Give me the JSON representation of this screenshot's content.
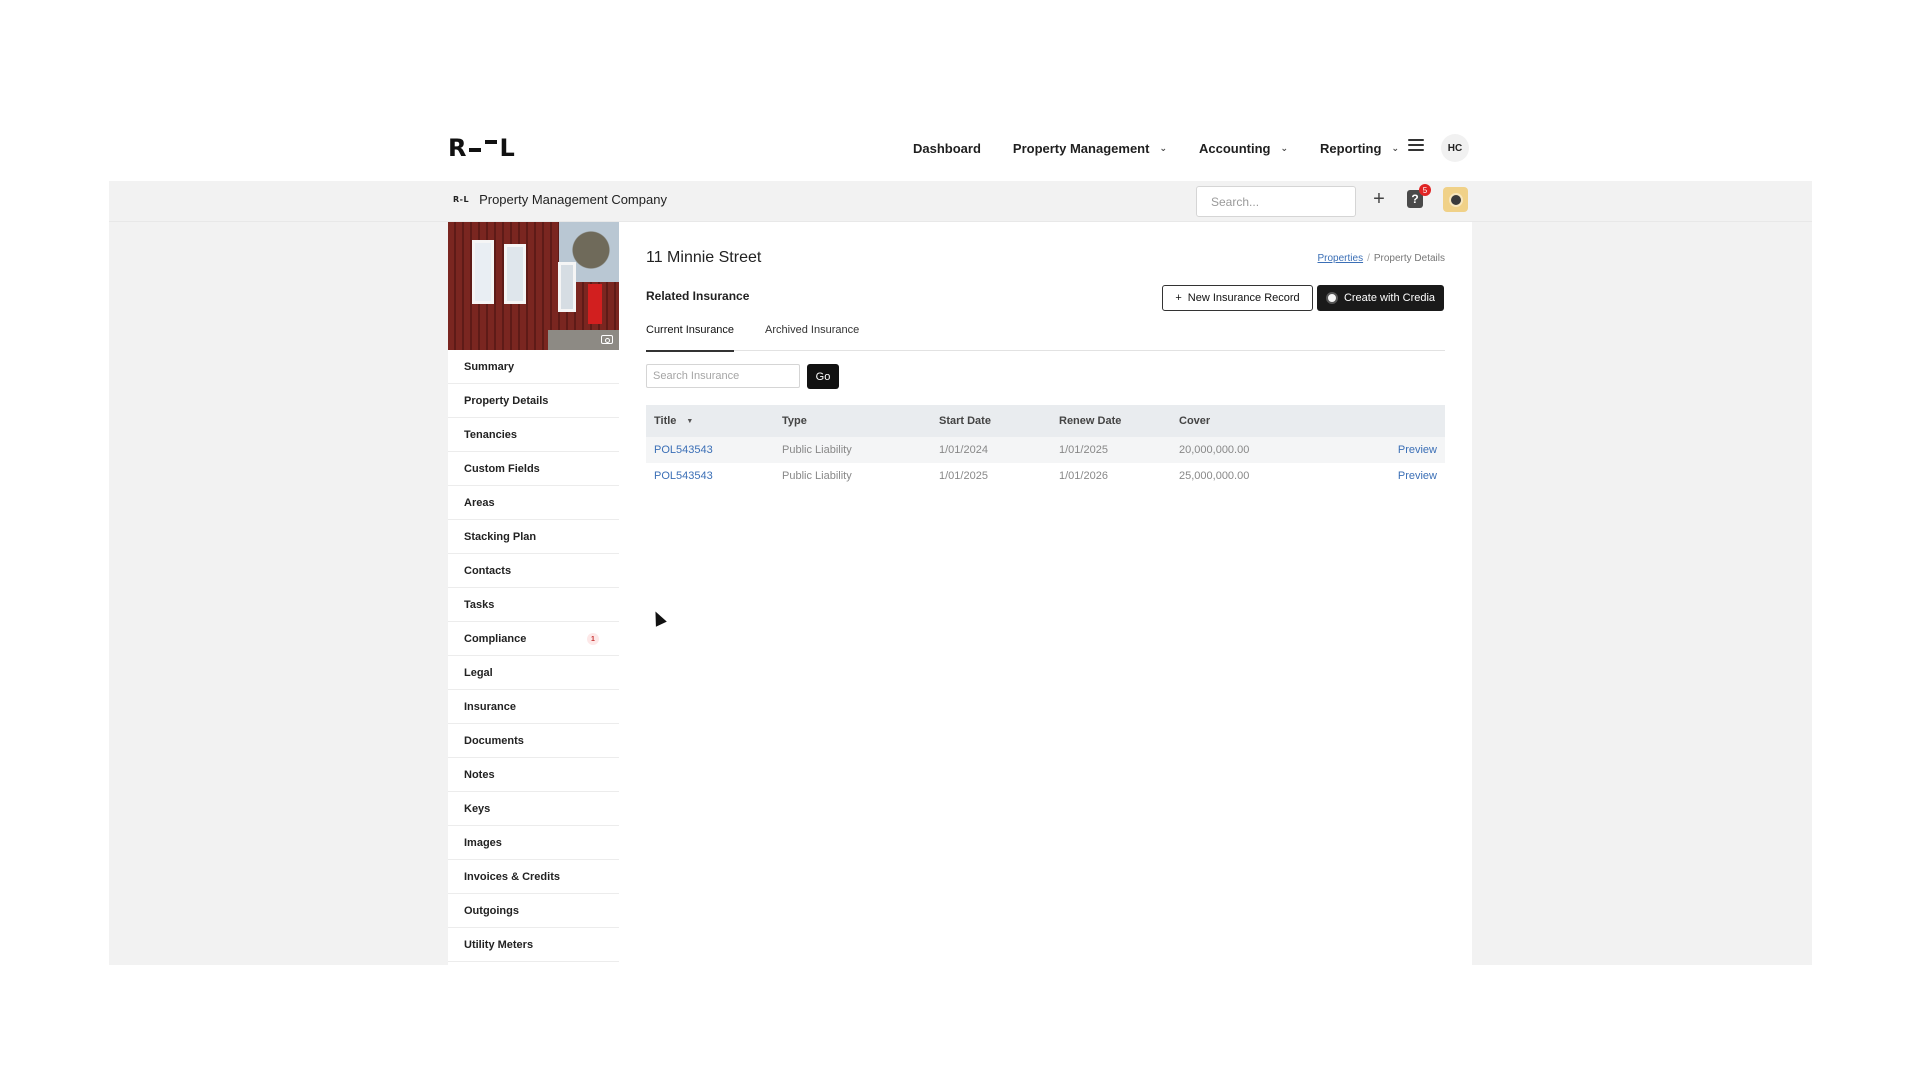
{
  "app": {
    "logo_text_left": "R",
    "logo_text_right": "L",
    "mini_logo": "R-L"
  },
  "nav": {
    "items": [
      {
        "label": "Dashboard",
        "dropdown": false
      },
      {
        "label": "Property Management",
        "dropdown": true
      },
      {
        "label": "Accounting",
        "dropdown": true
      },
      {
        "label": "Reporting",
        "dropdown": true
      }
    ],
    "user_initials": "HC"
  },
  "subheader": {
    "company": "Property Management Company",
    "search_placeholder": "Search...",
    "notification_count": "5",
    "help_glyph": "?"
  },
  "sidebar": {
    "items": [
      {
        "label": "Summary",
        "count": ""
      },
      {
        "label": "Property Details",
        "count": ""
      },
      {
        "label": "Tenancies",
        "count": ""
      },
      {
        "label": "Custom Fields",
        "count": ""
      },
      {
        "label": "Areas",
        "count": ""
      },
      {
        "label": "Stacking Plan",
        "count": ""
      },
      {
        "label": "Contacts",
        "count": ""
      },
      {
        "label": "Tasks",
        "count": ""
      },
      {
        "label": "Compliance",
        "count": "1"
      },
      {
        "label": "Legal",
        "count": ""
      },
      {
        "label": "Insurance",
        "count": ""
      },
      {
        "label": "Documents",
        "count": ""
      },
      {
        "label": "Notes",
        "count": ""
      },
      {
        "label": "Keys",
        "count": ""
      },
      {
        "label": "Images",
        "count": ""
      },
      {
        "label": "Invoices & Credits",
        "count": ""
      },
      {
        "label": "Outgoings",
        "count": ""
      },
      {
        "label": "Utility Meters",
        "count": ""
      }
    ]
  },
  "main": {
    "title": "11 Minnie Street",
    "breadcrumb": {
      "link": "Properties",
      "separator": "/",
      "current": "Property Details"
    },
    "section_title": "Related Insurance",
    "btn_new": "New Insurance Record",
    "btn_credia": "Create with Credia",
    "tabs": [
      {
        "label": "Current Insurance",
        "active": true
      },
      {
        "label": "Archived Insurance",
        "active": false
      }
    ],
    "search_placeholder": "Search Insurance",
    "go_label": "Go",
    "table": {
      "headers": [
        "Title",
        "Type",
        "Start Date",
        "Renew Date",
        "Cover"
      ],
      "rows": [
        {
          "title": "POL543543",
          "type": "Public Liability",
          "start": "1/01/2024",
          "renew": "1/01/2025",
          "cover": "20,000,000.00",
          "action": "Preview"
        },
        {
          "title": "POL543543",
          "type": "Public Liability",
          "start": "1/01/2025",
          "renew": "1/01/2026",
          "cover": "25,000,000.00",
          "action": "Preview"
        }
      ]
    }
  },
  "colors": {
    "accent_link": "#3b6fb6",
    "band_gray": "#f2f2f2",
    "badge_red": "#e02424"
  },
  "icons": [
    "chevron-down-icon",
    "hamburger-menu-icon",
    "plus-icon",
    "help-icon",
    "credia-icon",
    "camera-icon",
    "sort-icon",
    "mouse-cursor-icon"
  ]
}
